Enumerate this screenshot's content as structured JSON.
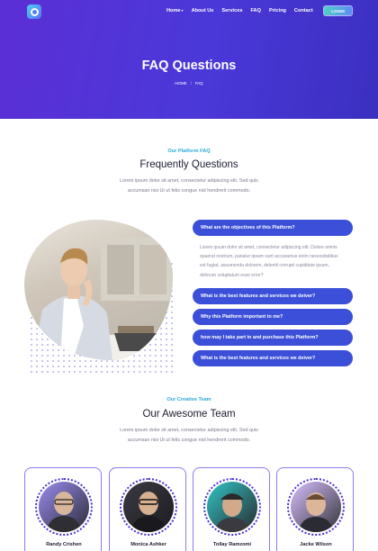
{
  "header": {
    "nav": [
      "Home",
      "About Us",
      "Services",
      "FAQ",
      "Pricing",
      "Contact"
    ],
    "login_label": "LOGIN"
  },
  "hero": {
    "title": "FAQ Questions",
    "breadcrumb": [
      "HOME",
      "FAQ"
    ]
  },
  "faq_section": {
    "eyebrow": "Our Platform FAQ",
    "title": "Frequently Questions",
    "description": "Lorem ipsum dolor sit amet, consectetur adipiscing elit. Sed quis accumsan nisi Ut ut felis congue nisl hendrerit commodo.",
    "questions": [
      "What are the objectives of this Platform?",
      "What is the best features and services we deiver?",
      "Why this Platform important to me?",
      "how may I take part in and purchase this Platform?",
      "What is the best features and services we deiver?"
    ],
    "open_answer": "Lorem ipsum dolor sit amet, consectetur adipiscing elit. Dolore omnis quaerat nostrum, pariatur ipsam sunt accusamus enim necessitatibus est fugiat, assumenda dolorem, deleniti corrupti cupiditate ipsum, dolorum voluptatum esse error?"
  },
  "team_section": {
    "eyebrow": "Our Creative Team",
    "title": "Our Awesome Team",
    "description": "Lorem ipsum dolor sit amet, consectetur adipiscing elit. Sed quis accumsan nisi Ut ut felis congue nisl hendrerit commodo.",
    "members": [
      "Randy Crishen",
      "Monica Ashker",
      "Tollay Ramzomi",
      "Jacke Wilson"
    ]
  },
  "colors": {
    "hero_gradient_start": "#5b2fd6",
    "hero_gradient_end": "#3b2fc0",
    "faq_button": "#3b4fd8",
    "accent_cyan": "#2aa8d8",
    "card_border": "#8e7cf0"
  }
}
